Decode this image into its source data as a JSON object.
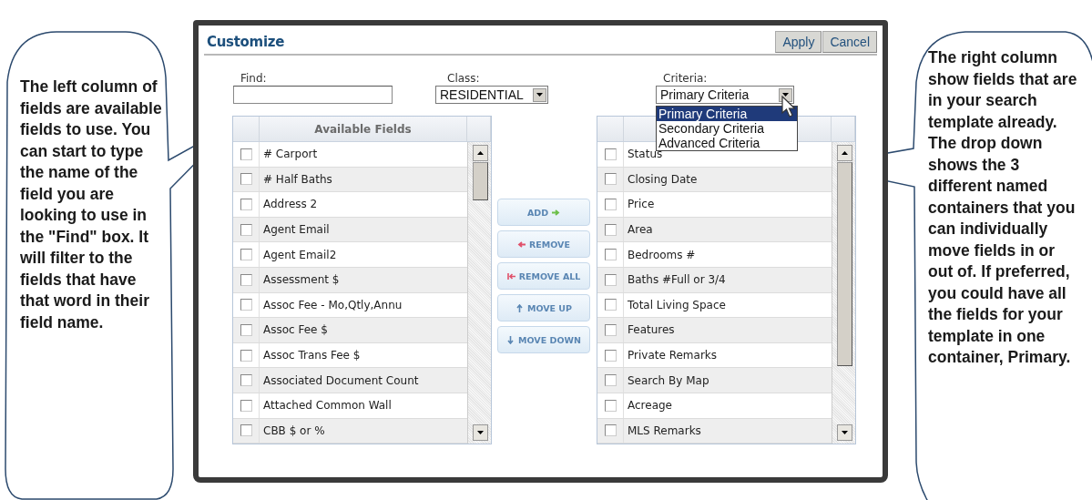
{
  "dialog": {
    "title": "Customize",
    "buttons": [
      "Apply",
      "Cancel"
    ],
    "find": {
      "label": "Find:"
    },
    "class_select": {
      "label": "Class:",
      "value": "RESIDENTIAL"
    },
    "criteria_select": {
      "label": "Criteria:",
      "value": "Primary Criteria",
      "expanded": true,
      "options": [
        {
          "label": "Primary Criteria",
          "selected": true
        },
        {
          "label": "Secondary Criteria",
          "selected": false
        },
        {
          "label": "Advanced Criteria",
          "selected": false
        }
      ]
    },
    "available_fields": {
      "heading": "Available Fields",
      "rows": [
        {
          "label": "# Carport",
          "checked": false
        },
        {
          "label": "# Half Baths",
          "checked": false
        },
        {
          "label": "Address 2",
          "checked": false
        },
        {
          "label": "Agent Email",
          "checked": false
        },
        {
          "label": "Agent Email2",
          "checked": false
        },
        {
          "label": "Assessment $",
          "checked": false
        },
        {
          "label": "Assoc Fee - Mo,Qtly,Annu",
          "checked": false
        },
        {
          "label": "Assoc Fee $",
          "checked": false
        },
        {
          "label": "Assoc Trans Fee $",
          "checked": false
        },
        {
          "label": "Associated Document Count",
          "checked": false
        },
        {
          "label": "Attached Common Wall",
          "checked": false
        },
        {
          "label": "CBB $ or %",
          "checked": false
        }
      ]
    },
    "actions": [
      {
        "label": "ADD",
        "kind": "add"
      },
      {
        "label": "REMOVE",
        "kind": "remove"
      },
      {
        "label": "REMOVE ALL",
        "kind": "remove_all"
      },
      {
        "label": "MOVE UP",
        "kind": "up"
      },
      {
        "label": "MOVE DOWN",
        "kind": "down"
      }
    ],
    "selected_fields": {
      "rows": [
        {
          "label": "Status",
          "checked": false
        },
        {
          "label": "Closing Date",
          "checked": false
        },
        {
          "label": "Price",
          "checked": false
        },
        {
          "label": "Area",
          "checked": false
        },
        {
          "label": "Bedrooms #",
          "checked": false
        },
        {
          "label": "Baths #Full or 3/4",
          "checked": false
        },
        {
          "label": "Total Living Space",
          "checked": false
        },
        {
          "label": "Features",
          "checked": false
        },
        {
          "label": "Private Remarks",
          "checked": false
        },
        {
          "label": "Search By Map",
          "checked": false
        },
        {
          "label": "Acreage",
          "checked": false
        },
        {
          "label": "MLS Remarks",
          "checked": false
        }
      ]
    }
  },
  "callouts": [
    {
      "text": "The left column of fields are available fields to use. You can start to type the name of the field you are looking to use in the \"Find\" box. It will filter to the fields that have that word in their field name."
    },
    {
      "text": "The right column show fields that are in your search template already. The drop down shows the 3 different named containers that you can individually move fields in or out of. If preferred, you could have all the fields for your template in one container, Primary."
    }
  ]
}
